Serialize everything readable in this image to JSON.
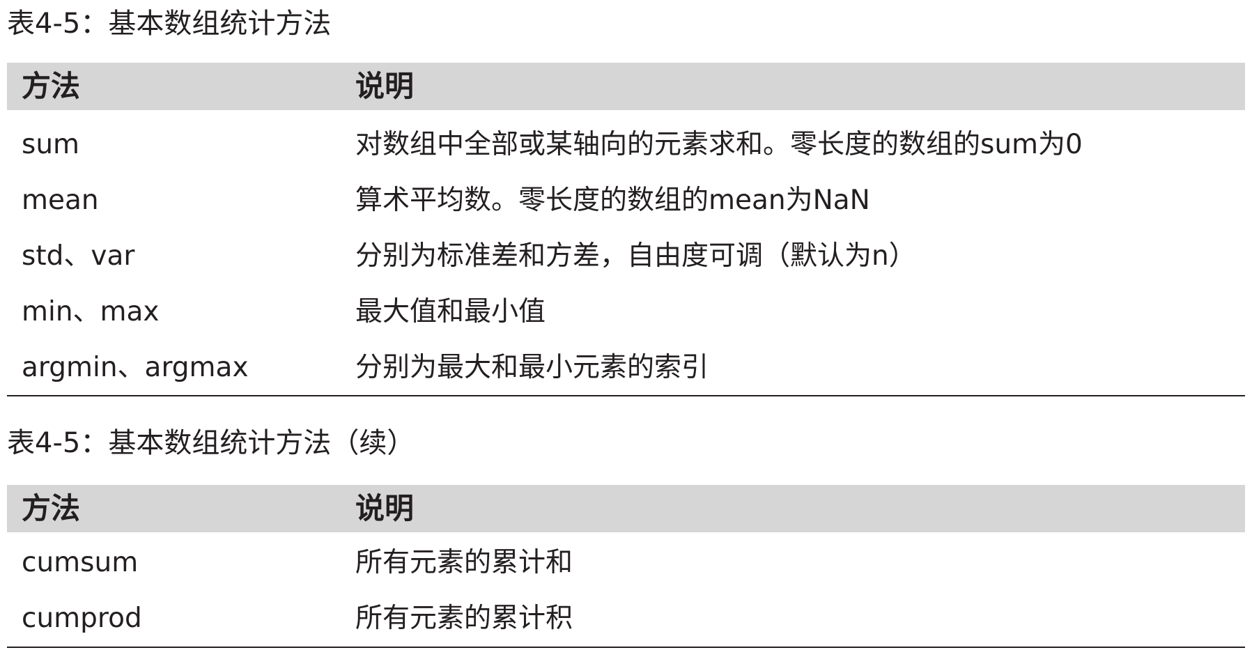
{
  "table1": {
    "caption": "表4-5：基本数组统计方法",
    "headers": [
      "方法",
      "说明"
    ],
    "rows": [
      {
        "method": "sum",
        "description": "对数组中全部或某轴向的元素求和。零长度的数组的sum为0"
      },
      {
        "method": "mean",
        "description": "算术平均数。零长度的数组的mean为NaN"
      },
      {
        "method": "std、var",
        "description": "分别为标准差和方差，自由度可调（默认为n）"
      },
      {
        "method": "min、max",
        "description": "最大值和最小值"
      },
      {
        "method": "argmin、argmax",
        "description": "分别为最大和最小元素的索引"
      }
    ]
  },
  "table2": {
    "caption": "表4-5：基本数组统计方法（续）",
    "headers": [
      "方法",
      "说明"
    ],
    "rows": [
      {
        "method": "cumsum",
        "description": "所有元素的累计和"
      },
      {
        "method": "cumprod",
        "description": "所有元素的累计积"
      }
    ]
  }
}
